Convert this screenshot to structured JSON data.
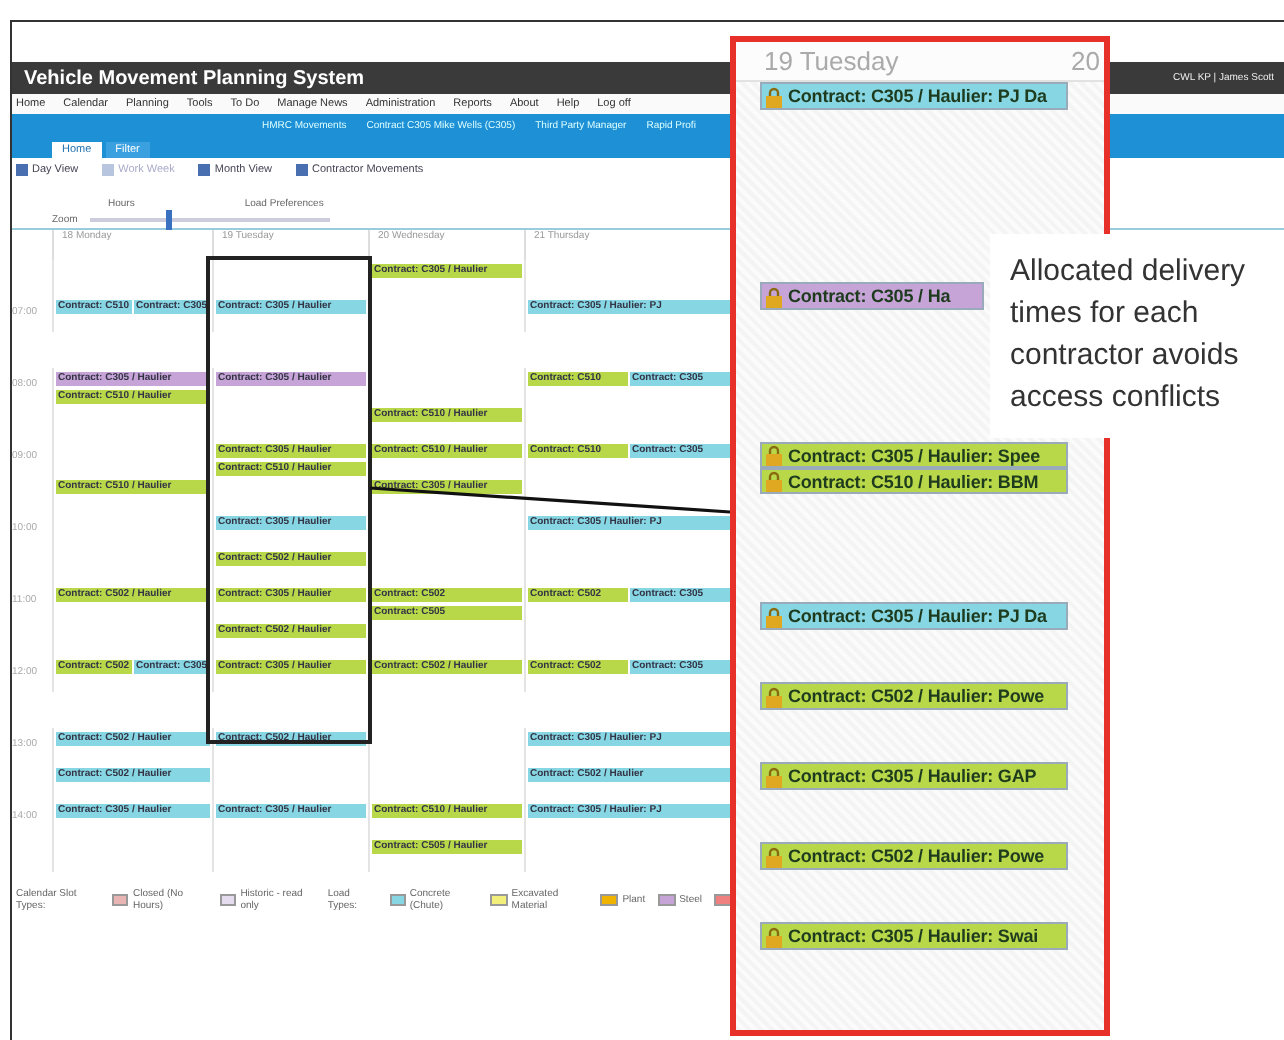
{
  "app": {
    "title": "Vehicle Movement Planning System",
    "user": "CWL KP | James Scott"
  },
  "menu": [
    "Home",
    "Calendar",
    "Planning",
    "Tools",
    "To Do",
    "Manage News",
    "Administration",
    "Reports",
    "About",
    "Help",
    "Log off"
  ],
  "links": [
    "HMRC Movements",
    "Contract C305 Mike Wells (C305)",
    "Third Party Manager",
    "Rapid Profi"
  ],
  "tabs": [
    {
      "label": "Home",
      "selected": true
    },
    {
      "label": "Filter",
      "selected": false
    }
  ],
  "toolbar": [
    {
      "label": "Day View",
      "disabled": false
    },
    {
      "label": "Work Week",
      "disabled": true
    },
    {
      "label": "Month View",
      "disabled": false
    },
    {
      "label": "Contractor Movements",
      "disabled": false
    }
  ],
  "slider": {
    "labels": [
      "Hours",
      "Load Preferences"
    ],
    "name": "Zoom",
    "level": 0.33
  },
  "calendar": {
    "days": [
      "18 Monday",
      "19 Tuesday",
      "20 Wednesday",
      "21 Thursday"
    ],
    "rows": [
      {
        "cells": [
          [],
          [],
          [
            {
              "text": "Contract: C305 / Haulier",
              "kind": "excavated"
            }
          ],
          []
        ]
      },
      {
        "time": "07:00",
        "cells": [
          [
            {
              "text": "Contract: C510",
              "kind": "concrete"
            },
            {
              "text": "Contract: C305",
              "kind": "concrete"
            }
          ],
          [
            {
              "text": "Contract: C305 / Haulier",
              "kind": "concrete"
            }
          ],
          [],
          [
            {
              "text": "Contract: C305 / Haulier: PJ",
              "kind": "concrete"
            }
          ]
        ]
      },
      {
        "time": "08:00",
        "cells": [
          [
            {
              "text": "Contract: C305 / Haulier",
              "kind": "steel"
            },
            {
              "text": "Contract: C510 / Haulier",
              "kind": "excavated"
            }
          ],
          [
            {
              "text": "Contract: C305 / Haulier",
              "kind": "steel"
            }
          ],
          [],
          [
            {
              "text": "Contract: C510",
              "kind": "excavated"
            },
            {
              "text": "Contract: C305",
              "kind": "concrete"
            }
          ]
        ]
      },
      {
        "cells": [
          [],
          [],
          [
            {
              "text": "Contract: C510 / Haulier",
              "kind": "excavated"
            }
          ],
          []
        ]
      },
      {
        "time": "09:00",
        "cells": [
          [],
          [
            {
              "text": "Contract: C305 / Haulier",
              "kind": "excavated"
            },
            {
              "text": "Contract: C510 / Haulier",
              "kind": "excavated"
            }
          ],
          [
            {
              "text": "Contract: C510 / Haulier",
              "kind": "excavated"
            }
          ],
          [
            {
              "text": "Contract: C510",
              "kind": "excavated"
            },
            {
              "text": "Contract: C305",
              "kind": "concrete"
            }
          ]
        ]
      },
      {
        "cells": [
          [
            {
              "text": "Contract: C510 / Haulier",
              "kind": "excavated"
            }
          ],
          [],
          [
            {
              "text": "Contract: C305 / Haulier",
              "kind": "excavated"
            }
          ],
          []
        ]
      },
      {
        "time": "10:00",
        "cells": [
          [],
          [
            {
              "text": "Contract: C305 / Haulier",
              "kind": "concrete"
            }
          ],
          [],
          [
            {
              "text": "Contract: C305 / Haulier: PJ",
              "kind": "concrete"
            }
          ]
        ]
      },
      {
        "cells": [
          [],
          [
            {
              "text": "Contract: C502 / Haulier",
              "kind": "excavated"
            }
          ],
          [],
          []
        ]
      },
      {
        "time": "11:00",
        "cells": [
          [
            {
              "text": "Contract: C502 / Haulier",
              "kind": "excavated"
            }
          ],
          [
            {
              "text": "Contract: C305 / Haulier",
              "kind": "excavated"
            }
          ],
          [
            {
              "text": "Contract: C502",
              "kind": "excavated"
            },
            {
              "text": "Contract: C505",
              "kind": "excavated"
            }
          ],
          [
            {
              "text": "Contract: C502",
              "kind": "excavated"
            },
            {
              "text": "Contract: C305",
              "kind": "concrete"
            }
          ]
        ]
      },
      {
        "cells": [
          [],
          [
            {
              "text": "Contract: C502 / Haulier",
              "kind": "excavated"
            }
          ],
          [],
          []
        ]
      },
      {
        "time": "12:00",
        "cells": [
          [
            {
              "text": "Contract: C502",
              "kind": "excavated"
            },
            {
              "text": "Contract: C305",
              "kind": "concrete"
            }
          ],
          [
            {
              "text": "Contract: C305 / Haulier",
              "kind": "excavated"
            }
          ],
          [
            {
              "text": "Contract: C502 / Haulier",
              "kind": "excavated"
            }
          ],
          [
            {
              "text": "Contract: C502",
              "kind": "excavated"
            },
            {
              "text": "Contract: C305",
              "kind": "concrete"
            }
          ]
        ]
      },
      {
        "time": "13:00",
        "cells": [
          [
            {
              "text": "Contract: C502 / Haulier",
              "kind": "concrete"
            }
          ],
          [
            {
              "text": "Contract: C502 / Haulier",
              "kind": "concrete"
            }
          ],
          [],
          [
            {
              "text": "Contract: C305 / Haulier: PJ",
              "kind": "concrete"
            }
          ]
        ]
      },
      {
        "cells": [
          [
            {
              "text": "Contract: C502 / Haulier",
              "kind": "concrete"
            }
          ],
          [],
          [],
          [
            {
              "text": "Contract: C502 / Haulier",
              "kind": "concrete"
            }
          ]
        ]
      },
      {
        "time": "14:00",
        "cells": [
          [
            {
              "text": "Contract: C305 / Haulier",
              "kind": "concrete"
            }
          ],
          [
            {
              "text": "Contract: C305 / Haulier",
              "kind": "concrete"
            }
          ],
          [
            {
              "text": "Contract: C510 / Haulier",
              "kind": "excavated"
            }
          ],
          [
            {
              "text": "Contract: C305 / Haulier: PJ",
              "kind": "concrete"
            }
          ]
        ]
      },
      {
        "cells": [
          [],
          [],
          [
            {
              "text": "Contract: C505 / Haulier",
              "kind": "excavated"
            }
          ],
          []
        ]
      }
    ]
  },
  "legend": [
    {
      "kind": "heading",
      "label": "Calendar Slot Types:"
    },
    {
      "kind": "swatch",
      "label": "Closed (No Hours)",
      "color": "#e8b4b4"
    },
    {
      "kind": "swatch",
      "label": "Historic - read only",
      "color": "#e6dcef"
    },
    {
      "kind": "heading",
      "label": "Load Types:"
    },
    {
      "kind": "swatch",
      "label": "Concrete (Chute)",
      "color": "#86d6e3"
    },
    {
      "kind": "swatch",
      "label": "Excavated Material",
      "color": "#f2ef7a"
    },
    {
      "kind": "swatch",
      "label": "Plant",
      "color": "#f0b400"
    },
    {
      "kind": "swatch",
      "label": "Steel",
      "color": "#c6a4d8"
    },
    {
      "kind": "swatch",
      "color": "#f08080"
    }
  ],
  "zoom": {
    "day": "19 Tuesday",
    "next_day": "20",
    "groups": [
      [
        {
          "text": "Contract: C305 / Haulier: PJ Da",
          "kind": "concrete"
        }
      ],
      [
        {
          "text": "Contract: C305 / Ha",
          "kind": "steel"
        }
      ],
      [
        {
          "text": "Contract: C305 / Haulier: Spee",
          "kind": "excavated"
        },
        {
          "text": "Contract: C510 / Haulier: BBM",
          "kind": "excavated"
        }
      ],
      [
        {
          "text": "Contract: C305 / Haulier: PJ Da",
          "kind": "concrete"
        }
      ],
      [
        {
          "text": "Contract: C502 / Haulier: Powe",
          "kind": "excavated"
        }
      ],
      [
        {
          "text": "Contract: C305 / Haulier: GAP",
          "kind": "excavated"
        }
      ],
      [
        {
          "text": "Contract: C502 / Haulier: Powe",
          "kind": "excavated"
        }
      ],
      [
        {
          "text": "Contract: C305 / Haulier: Swai",
          "kind": "excavated"
        }
      ]
    ]
  },
  "callout": "Allocated delivery times for each contractor avoids access conflicts"
}
